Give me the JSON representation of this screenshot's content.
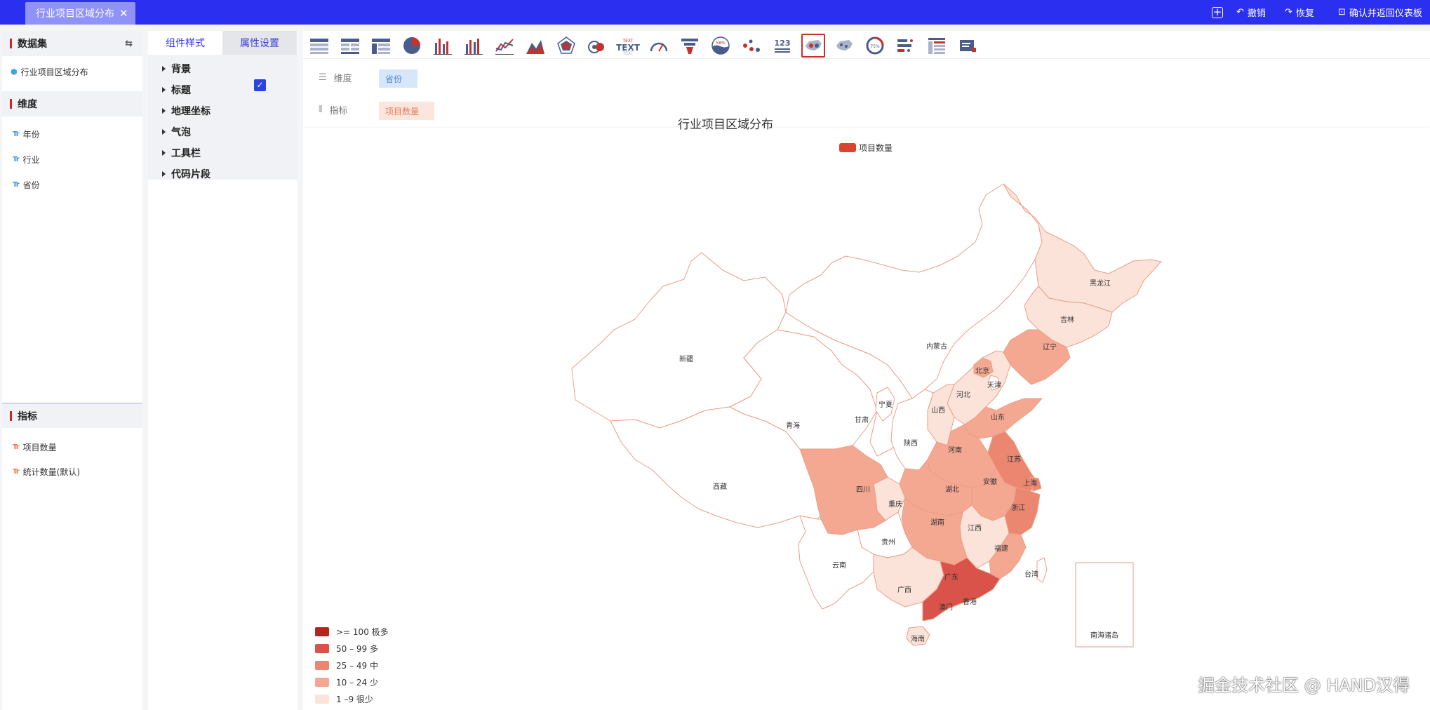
{
  "topbar": {
    "tab_label": "行业项目区域分布",
    "tab_close": "✕",
    "add_icon_glyph": "+",
    "undo_label": "撤销",
    "redo_label": "恢复",
    "confirm_label": "确认并返回仪表板"
  },
  "left_panel": {
    "dataset_header": "数据集",
    "dataset_name": "行业项目区域分布",
    "dimension_header": "维度",
    "dimensions": [
      "年份",
      "行业",
      "省份"
    ],
    "metric_header": "指标",
    "metrics": [
      "项目数量",
      "统计数量(默认)"
    ],
    "field_type_glyph": "Tr"
  },
  "middle_panel": {
    "tab_style": "组件样式",
    "tab_props": "属性设置",
    "tree_items": [
      "背景",
      "标题",
      "地理坐标",
      "气泡",
      "工具栏",
      "代码片段"
    ],
    "title_checked": true
  },
  "toolbar": {
    "chart_types": [
      "table-basic-icon",
      "table-summary-icon",
      "table-pivot-icon",
      "pie-icon",
      "bar-icon",
      "bar-stacked-icon",
      "line-icon",
      "area-icon",
      "radar-icon",
      "sankey-icon",
      "text-icon",
      "gauge-icon",
      "funnel-icon",
      "liquid-icon",
      "scatter-icon",
      "number-icon",
      "map-icon",
      "map-bubble-icon",
      "progress-ring-icon",
      "progress-bar-icon",
      "table-detail-icon",
      "richtext-icon"
    ],
    "active": "map-icon",
    "text_icon_label": "TEXT",
    "number_icon_label": "123",
    "liquid_label": "58%",
    "ring_label": "75%"
  },
  "dimension_row": {
    "label": "维度",
    "value": "省份"
  },
  "metric_row": {
    "label": "指标",
    "value": "项目数量"
  },
  "chart": {
    "title": "行业项目区域分布",
    "legend_series": "项目数量",
    "inset_label": "南海诸岛"
  },
  "chart_data": {
    "type": "map",
    "series": "项目数量",
    "legend": [
      {
        "label": ">= 100  极多",
        "color": "#b3261e"
      },
      {
        "label": "50 – 99  多",
        "color": "#d9534a"
      },
      {
        "label": "25 – 49  中",
        "color": "#eb8670"
      },
      {
        "label": "10 – 24  少",
        "color": "#f4a892"
      },
      {
        "label": "1 –9 很少",
        "color": "#fbe3d9"
      }
    ],
    "regions": [
      {
        "name": "黑龙江",
        "level": 5
      },
      {
        "name": "吉林",
        "level": 5
      },
      {
        "name": "辽宁",
        "level": 4
      },
      {
        "name": "内蒙古",
        "level": 0
      },
      {
        "name": "北京",
        "level": 4
      },
      {
        "name": "天津",
        "level": 0
      },
      {
        "name": "河北",
        "level": 5
      },
      {
        "name": "山西",
        "level": 5
      },
      {
        "name": "山东",
        "level": 4
      },
      {
        "name": "河南",
        "level": 4
      },
      {
        "name": "江苏",
        "level": 3
      },
      {
        "name": "上海",
        "level": 3
      },
      {
        "name": "安徽",
        "level": 4
      },
      {
        "name": "湖北",
        "level": 4
      },
      {
        "name": "浙江",
        "level": 3
      },
      {
        "name": "江西",
        "level": 5
      },
      {
        "name": "湖南",
        "level": 4
      },
      {
        "name": "福建",
        "level": 4
      },
      {
        "name": "广东",
        "level": 2
      },
      {
        "name": "广西",
        "level": 5
      },
      {
        "name": "海南",
        "level": 5
      },
      {
        "name": "四川",
        "level": 4
      },
      {
        "name": "重庆",
        "level": 5
      },
      {
        "name": "贵州",
        "level": 0
      },
      {
        "name": "云南",
        "level": 0
      },
      {
        "name": "西藏",
        "level": 0
      },
      {
        "name": "新疆",
        "level": 0
      },
      {
        "name": "青海",
        "level": 0
      },
      {
        "name": "甘肃",
        "level": 0
      },
      {
        "name": "宁夏",
        "level": 0
      },
      {
        "name": "陕西",
        "level": 0
      },
      {
        "name": "台湾",
        "level": 0
      },
      {
        "name": "香港",
        "level": 0
      },
      {
        "name": "澳门",
        "level": 0
      }
    ]
  },
  "watermark": "掘金技术社区 @ HAND汉得"
}
